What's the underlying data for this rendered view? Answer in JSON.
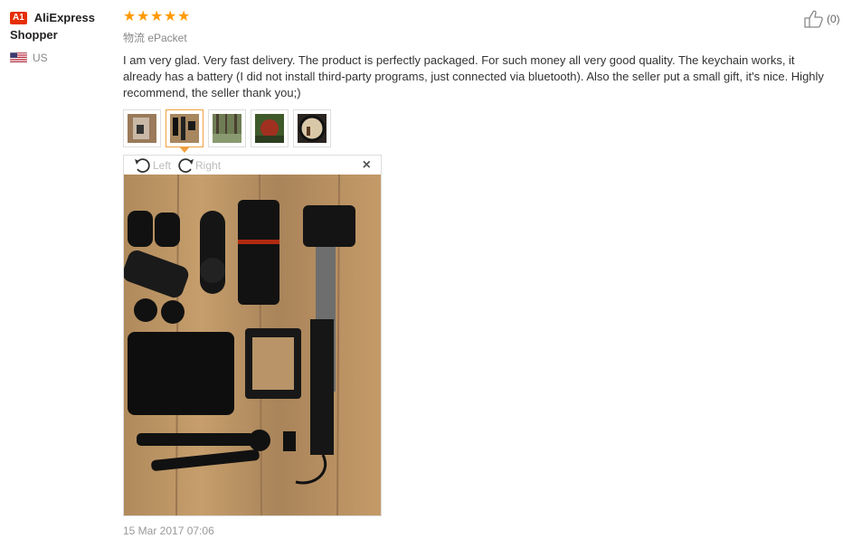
{
  "user": {
    "badge": "A1",
    "name_line1": "AliExpress",
    "name_line2": "Shopper",
    "country": "US"
  },
  "rating": {
    "stars": 5
  },
  "helpful": {
    "count": "(0)"
  },
  "shipping": "物流 ePacket",
  "review_text": "I am very glad. Very fast delivery. The product is perfectly packaged. For such money all very good quality. The keychain works, it already has a battery (I did not install third-party programs, just connected via bluetooth). Also the seller put a small gift, it's nice. Highly recommend, the seller thank you;)",
  "viewer": {
    "rotate_left": "Left",
    "rotate_right": "Right",
    "close": "×"
  },
  "date": "15 Mar 2017 07:06",
  "colors": {
    "star": "#ff9a00",
    "badge": "#e62e04",
    "active_thumb": "#f0a040"
  }
}
